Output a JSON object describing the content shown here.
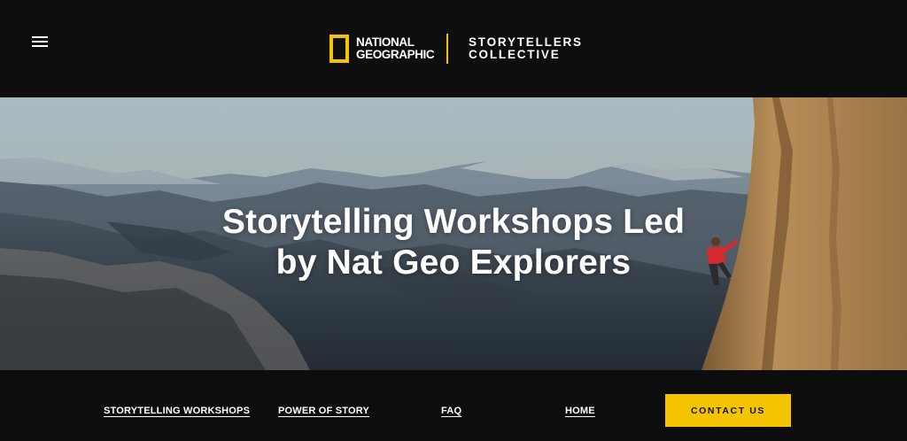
{
  "header": {
    "menu_icon": "hamburger-menu-icon",
    "logo": {
      "brand_line1": "NATIONAL",
      "brand_line2": "GEOGRAPHIC",
      "brand_color": "#f5c400"
    },
    "collective_line1": "STORYTELLERS",
    "collective_line2": "COLLECTIVE"
  },
  "hero": {
    "title_line1": "Storytelling Workshops Led",
    "title_line2": "by Nat Geo Explorers"
  },
  "nav": {
    "workshops": "STORYTELLING WORKSHOPS",
    "power": "POWER OF STORY",
    "faq": "FAQ",
    "home": "HOME",
    "contact": "CONTACT US"
  },
  "colors": {
    "accent": "#f5c400",
    "background": "#0d0d0d",
    "text": "#ffffff"
  }
}
